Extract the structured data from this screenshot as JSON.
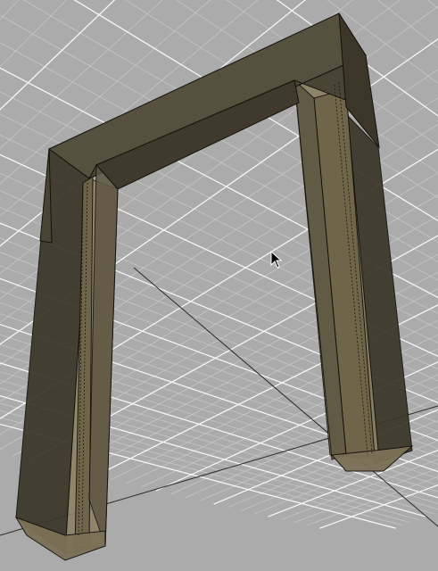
{
  "viewport": {
    "background": "#ababab",
    "tool": "3d-viewport",
    "cursor_icon": "arrow-pointer-icon"
  },
  "scene": {
    "object": "door-frame",
    "parts": [
      "lintel-beam",
      "left-post",
      "right-post"
    ],
    "colors": {
      "frame_top": "#56503f",
      "frame_side_dark": "#3b3628",
      "frame_inner_light": "#8b8164",
      "frame_inner_mid": "#6e6549",
      "grid_minor": "#d4d4d4",
      "grid_major": "#ffffff",
      "axis_line": "#2a2a2a"
    },
    "grid": {
      "visible": true,
      "type": "ground-plane"
    }
  }
}
